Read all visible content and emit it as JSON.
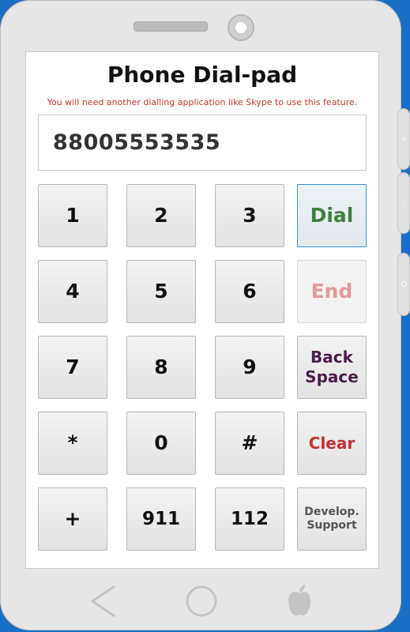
{
  "title": "Phone Dial-pad",
  "notice": "You will need another dialling application like Skype to use this feature.",
  "display_value": "88005553535",
  "side_buttons": [
    "+",
    "-",
    "O"
  ],
  "keys": {
    "k1": "1",
    "k2": "2",
    "k3": "3",
    "dial": "Dial",
    "k4": "4",
    "k5": "5",
    "k6": "6",
    "end": "End",
    "k7": "7",
    "k8": "8",
    "k9": "9",
    "back_line1": "Back",
    "back_line2": "Space",
    "star": "*",
    "k0": "0",
    "hash": "#",
    "clear": "Clear",
    "plus": "+",
    "k911": "911",
    "k112": "112",
    "support_line1": "Develop.",
    "support_line2": "Support"
  },
  "colors": {
    "dial": "#3f7f3f",
    "end": "#e29a9a",
    "backspace": "#4a1d4a",
    "clear": "#c43030",
    "notice": "#c0392b"
  },
  "nav_icons": [
    "back-arrow-icon",
    "home-circle-icon",
    "apple-logo-icon"
  ]
}
